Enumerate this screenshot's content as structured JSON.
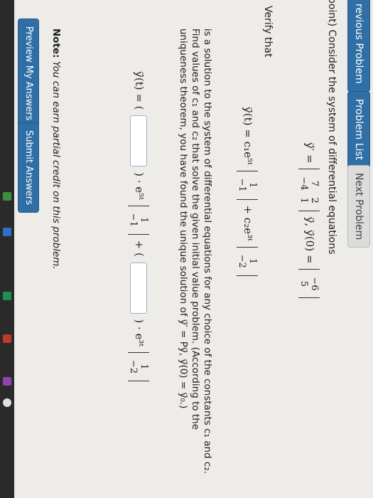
{
  "nav": {
    "previous": "revious Problem",
    "list": "Problem List",
    "next": "Next Problem"
  },
  "problem": {
    "intro": "point) Consider the system of differential equations",
    "system_eq_lhs": "y⃗′ =",
    "matrix": [
      [
        "7",
        "2"
      ],
      [
        "−4",
        "1"
      ]
    ],
    "after_matrix": "y⃗,  y⃗(0) =",
    "initial_vector": [
      "−6",
      "5"
    ],
    "verify_label": "Verify that",
    "solution_lhs": "y⃗(t) = c₁e⁵ᵗ",
    "vector1": [
      "1",
      "−1"
    ],
    "solution_plus": "+ c₂e³ᵗ",
    "vector2": [
      "1",
      "−2"
    ],
    "paragraph": "is a solution to the system of differential equations for any choice of the constants c₁ and c₂. Find values of c₁ and c₂ that solve the given initial value problem. (According to the uniqueness theorem, you have found the unique solution of y⃗′ = Py⃗, y⃗(0) = y⃗₀.)",
    "answer_lhs": "y⃗(t) = (",
    "answer_mid1": ") · e⁵ᵗ",
    "answer_plus": "+ (",
    "answer_mid2": ") · e³ᵗ"
  },
  "note": {
    "label": "Note:",
    "text": "You can earn partial credit on this problem."
  },
  "buttons": {
    "preview": "Preview My Answers",
    "submit": "Submit Answers"
  }
}
